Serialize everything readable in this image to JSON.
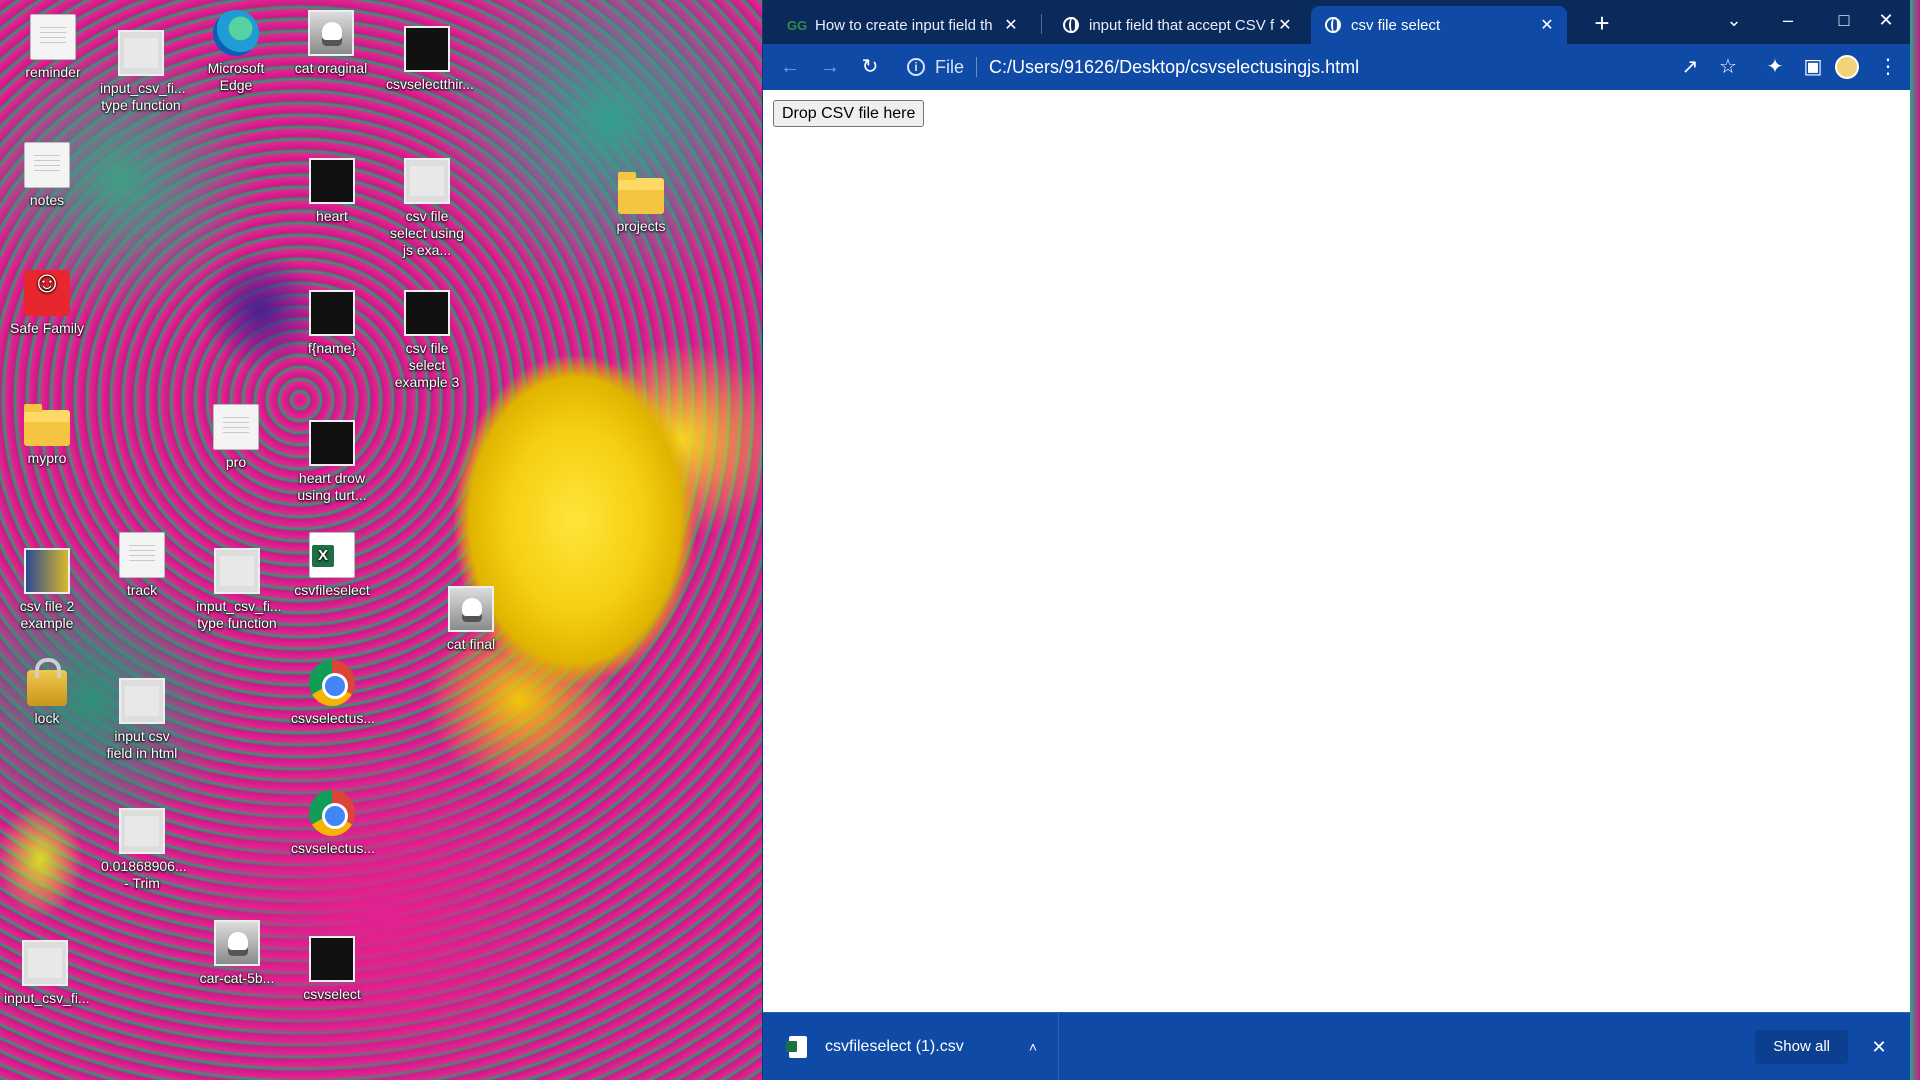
{
  "desktop": {
    "icons": [
      {
        "label": "reminder",
        "type": "doc"
      },
      {
        "label": "input_csv_fi... type function",
        "type": "video-light"
      },
      {
        "label": "Microsoft Edge",
        "type": "edge"
      },
      {
        "label": "cat oraginal",
        "type": "photo"
      },
      {
        "label": "csvselectthir...",
        "type": "video"
      },
      {
        "label": "notes",
        "type": "doc"
      },
      {
        "label": "heart",
        "type": "video"
      },
      {
        "label": "csv file select using js exa...",
        "type": "video-light"
      },
      {
        "label": "projects",
        "type": "folder"
      },
      {
        "label": "Safe Family",
        "type": "family"
      },
      {
        "label": "f{name}",
        "type": "video"
      },
      {
        "label": "csv file select example 3",
        "type": "video"
      },
      {
        "label": "mypro",
        "type": "folder"
      },
      {
        "label": "pro",
        "type": "doc"
      },
      {
        "label": "heart drow using turt...",
        "type": "video"
      },
      {
        "label": "csv file 2 example",
        "type": "film"
      },
      {
        "label": "track",
        "type": "doc"
      },
      {
        "label": "input_csv_fi... type function",
        "type": "video-light"
      },
      {
        "label": "csvfileselect",
        "type": "excel"
      },
      {
        "label": "cat final",
        "type": "photo"
      },
      {
        "label": "lock",
        "type": "lock"
      },
      {
        "label": "input csv field in html",
        "type": "video-light"
      },
      {
        "label": "csvselectus...",
        "type": "chrome"
      },
      {
        "label": "0.01868906... - Trim",
        "type": "video-light"
      },
      {
        "label": "csvselectus...",
        "type": "chrome"
      },
      {
        "label": "input_csv_fi...",
        "type": "video-light"
      },
      {
        "label": "car-cat-5b...",
        "type": "photo"
      },
      {
        "label": "csvselect",
        "type": "video"
      }
    ]
  },
  "browser": {
    "tabs": [
      {
        "title": "How to create input field th",
        "favicon": "gfg-icon",
        "favicon_text": "GG"
      },
      {
        "title": "input field that accept CSV f",
        "favicon": "globe-icon"
      },
      {
        "title": "csv file select",
        "favicon": "globe-icon",
        "active": true
      }
    ],
    "new_tab_label": "+",
    "window_controls": {
      "tab_search": "⌄",
      "minimize": "–",
      "maximize": "□",
      "close": "✕"
    },
    "toolbar": {
      "back": "←",
      "forward": "→",
      "reload": "↻",
      "scheme_label": "File",
      "url": "C:/Users/91626/Desktop/csvselectusingjs.html",
      "share": "↗",
      "bookmark": "☆",
      "extensions": "✦",
      "side_panel": "▣",
      "menu": "⋮"
    },
    "page": {
      "drop_button_label": "Drop CSV file here"
    },
    "download_bar": {
      "file_name": "csvfileselect (1).csv",
      "chevron": "˄",
      "show_all_label": "Show all",
      "close": "✕"
    }
  },
  "colors": {
    "titlebar": "#0b2a5c",
    "toolbar": "#0e4aa6",
    "active_tab": "#0e4aa6"
  }
}
